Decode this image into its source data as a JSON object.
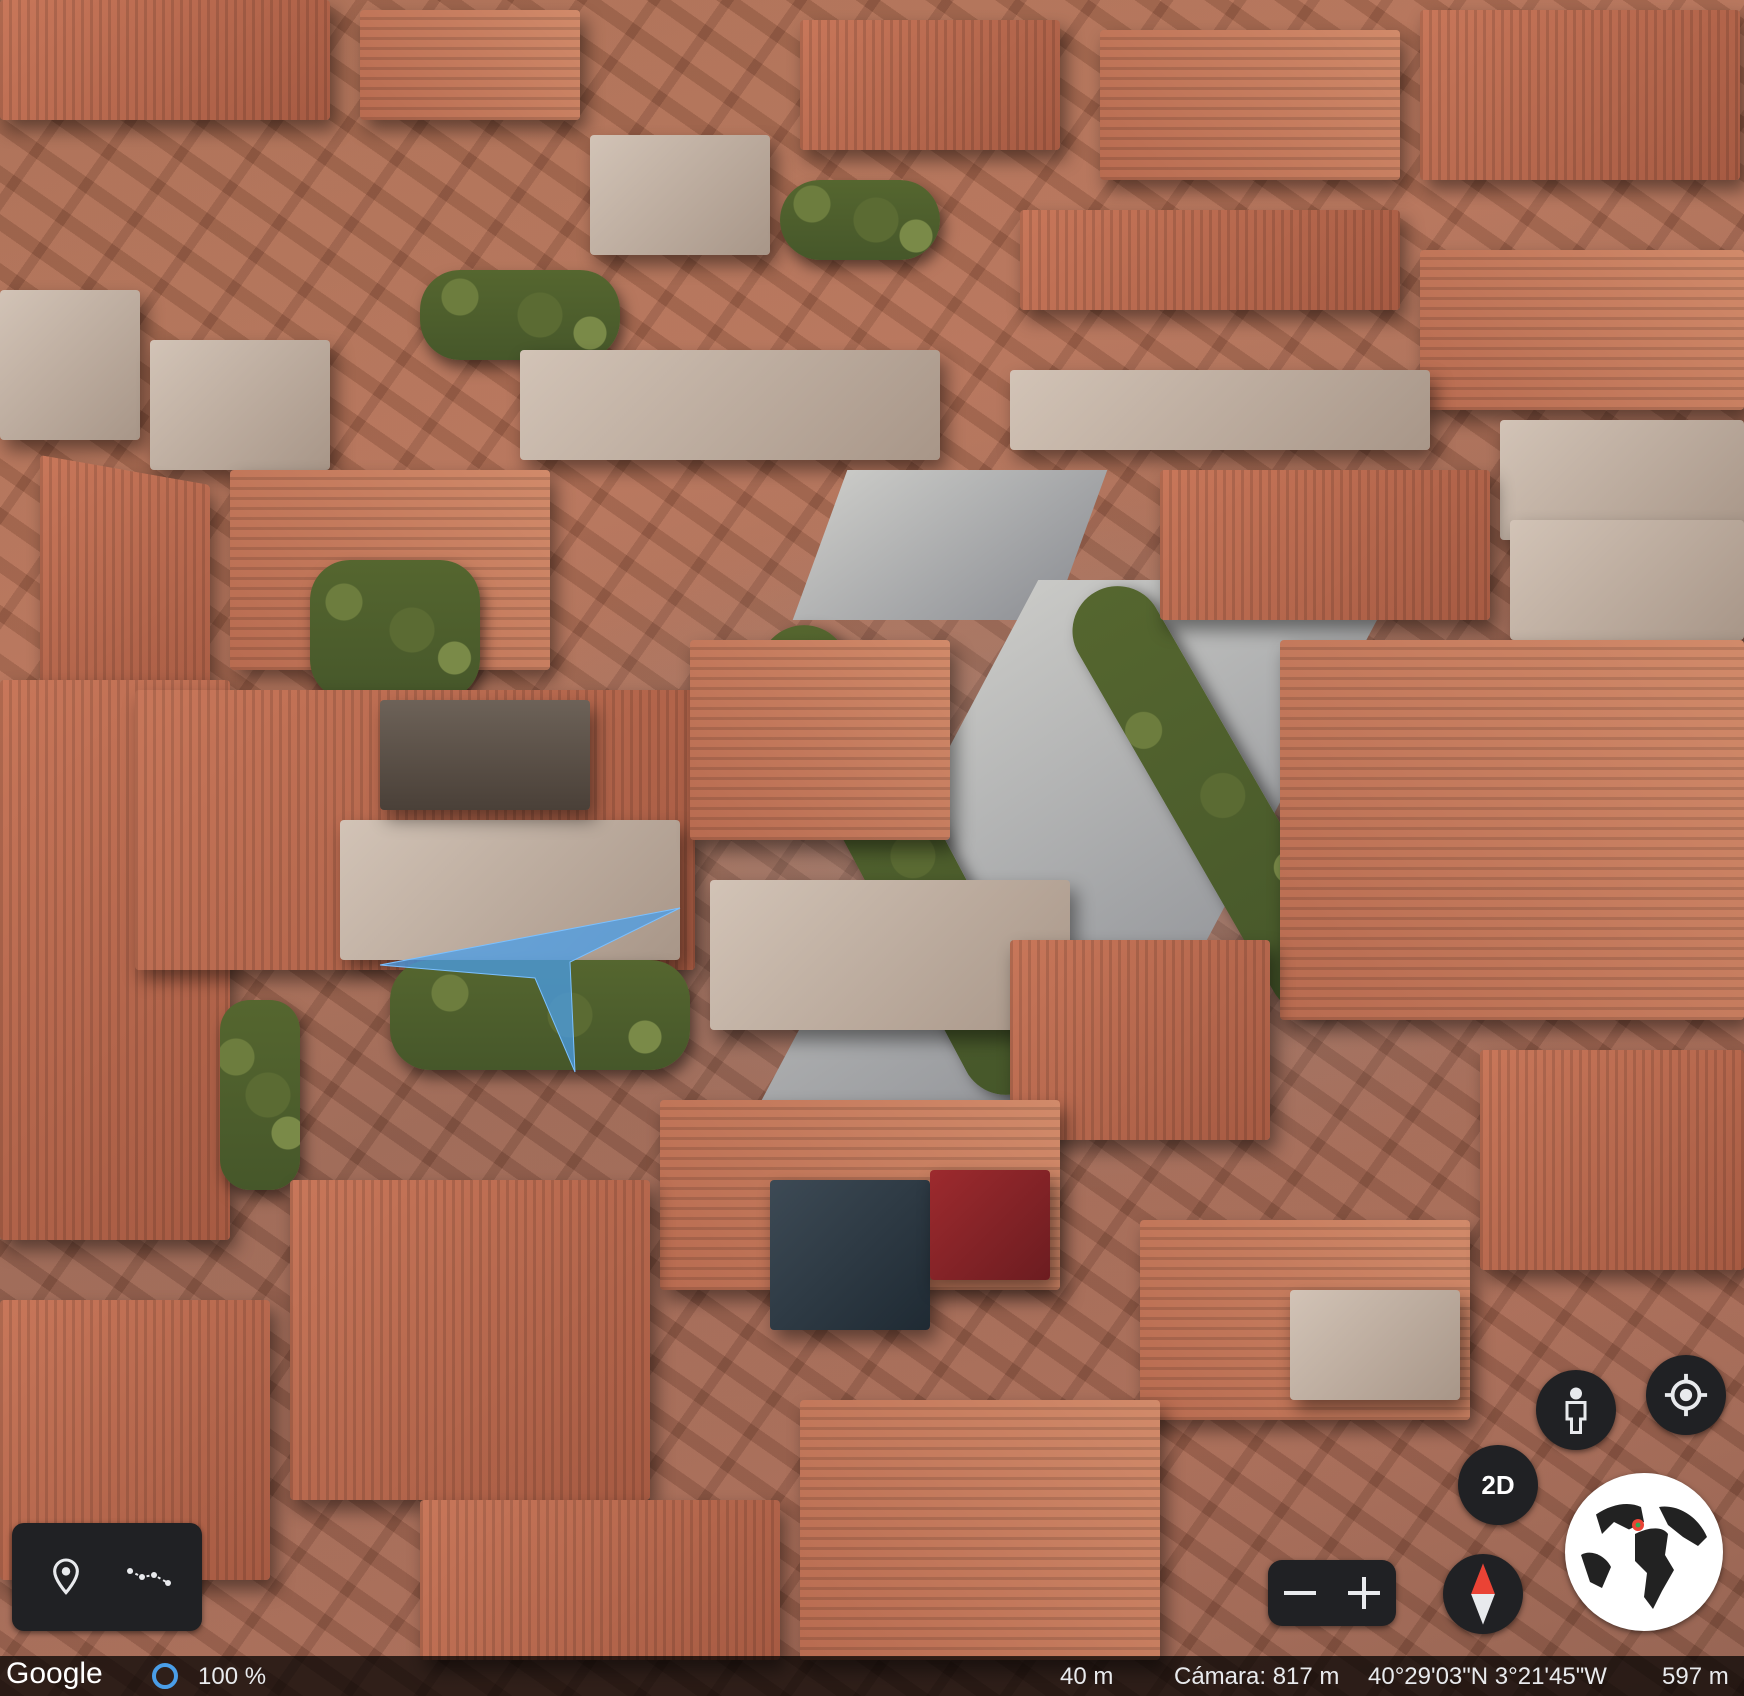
{
  "app": {
    "brand": "Google"
  },
  "status_bar": {
    "load_progress": "100 %",
    "scale": "40 m",
    "camera": "Cámara: 817 m",
    "coordinates": "40°29'03\"N 3°21'45\"W",
    "elevation": "597 m"
  },
  "controls": {
    "view_mode_label": "2D",
    "zoom_out_symbol": "—",
    "zoom_in_symbol": "+"
  },
  "icons": {
    "place": "map-pin-icon",
    "measure": "measure-distance-icon",
    "street_view": "pegman-icon",
    "my_location": "my-location-icon",
    "compass": "compass-icon",
    "globe": "globe-icon",
    "loading": "loading-ring-icon"
  },
  "colors": {
    "control_bg": "#202124",
    "accent_blue": "#4a9ee8",
    "compass_red": "#ea4335"
  }
}
